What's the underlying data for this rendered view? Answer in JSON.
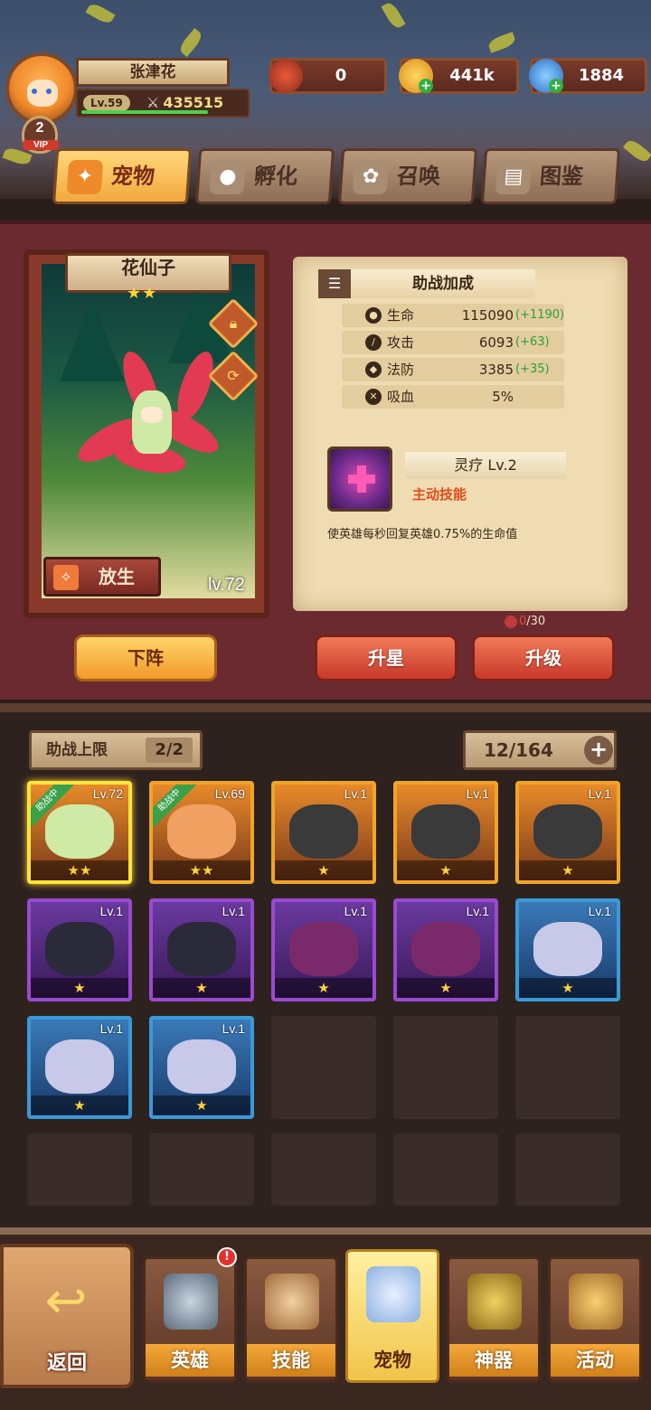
{
  "player": {
    "name": "张津花",
    "level": "Lv.59",
    "power": "435515",
    "vip_level": "2",
    "vip_label": "VIP"
  },
  "currencies": [
    {
      "name": "red-gem",
      "value": "0",
      "color": "#d0402a"
    },
    {
      "name": "gold-coin",
      "value": "441k",
      "color": "#f2b028"
    },
    {
      "name": "diamond",
      "value": "1884",
      "color": "#3a8ae8"
    }
  ],
  "top_tabs": [
    {
      "label": "宠物",
      "icon": "fox-icon",
      "active": true
    },
    {
      "label": "孵化",
      "icon": "egg-icon",
      "active": false
    },
    {
      "label": "召唤",
      "icon": "paw-icon",
      "active": false
    },
    {
      "label": "图鉴",
      "icon": "book-icon",
      "active": false
    }
  ],
  "pet": {
    "name": "花仙子",
    "stars": "★★",
    "level": "lv.72",
    "release_label": "放生"
  },
  "bonus": {
    "title": "助战加成",
    "stats": [
      {
        "icon": "drop-icon",
        "label": "生命",
        "value": "115090",
        "bonus": "(+1190)"
      },
      {
        "icon": "sword-icon",
        "label": "攻击",
        "value": "6093",
        "bonus": "(+63)"
      },
      {
        "icon": "shield-icon",
        "label": "法防",
        "value": "3385",
        "bonus": "(+35)"
      },
      {
        "icon": "swords-icon",
        "label": "吸血",
        "value": "5%",
        "bonus": ""
      }
    ]
  },
  "skill": {
    "name": "灵疗 Lv.2",
    "type": "主动技能",
    "description": "使英雄每秒回复英雄0.75%的生命值"
  },
  "upgrade_cost": {
    "have": "0",
    "need": "/30"
  },
  "actions": {
    "unassign": "下阵",
    "star_up": "升星",
    "level_up": "升级"
  },
  "list": {
    "assist_limit_label": "助战上限",
    "assist_limit_value": "2/2",
    "capacity": "12/164",
    "add": "+",
    "pets": [
      {
        "level": "Lv.72",
        "rarity": "gold",
        "stars": "★★",
        "in_battle": true,
        "ribbon": "助战中",
        "color": "#cfe9a6"
      },
      {
        "level": "Lv.69",
        "rarity": "gold",
        "stars": "★★",
        "in_battle": true,
        "ribbon": "助战中",
        "color": "#f0a060"
      },
      {
        "level": "Lv.1",
        "rarity": "gold",
        "stars": "★",
        "in_battle": false,
        "ribbon": "",
        "color": "#3a3a3a"
      },
      {
        "level": "Lv.1",
        "rarity": "gold",
        "stars": "★",
        "in_battle": false,
        "ribbon": "",
        "color": "#3a3a3a"
      },
      {
        "level": "Lv.1",
        "rarity": "gold",
        "stars": "★",
        "in_battle": false,
        "ribbon": "",
        "color": "#3a3a3a"
      },
      {
        "level": "Lv.1",
        "rarity": "purple",
        "stars": "★",
        "in_battle": false,
        "ribbon": "",
        "color": "#2a2a3a"
      },
      {
        "level": "Lv.1",
        "rarity": "purple",
        "stars": "★",
        "in_battle": false,
        "ribbon": "",
        "color": "#2a2a3a"
      },
      {
        "level": "Lv.1",
        "rarity": "purple",
        "stars": "★",
        "in_battle": false,
        "ribbon": "",
        "color": "#7a2a6a"
      },
      {
        "level": "Lv.1",
        "rarity": "purple",
        "stars": "★",
        "in_battle": false,
        "ribbon": "",
        "color": "#7a2a6a"
      },
      {
        "level": "Lv.1",
        "rarity": "blue",
        "stars": "★",
        "in_battle": false,
        "ribbon": "",
        "color": "#c8c8e8"
      },
      {
        "level": "Lv.1",
        "rarity": "blue",
        "stars": "★",
        "in_battle": false,
        "ribbon": "",
        "color": "#c8c8e8"
      },
      {
        "level": "Lv.1",
        "rarity": "blue",
        "stars": "★",
        "in_battle": false,
        "ribbon": "",
        "color": "#c8c8e8"
      }
    ]
  },
  "bottom_nav": {
    "back": "返回",
    "notify": "!",
    "items": [
      {
        "label": "英雄",
        "icon": "knight-helmet-icon",
        "active": false,
        "color": "#8a9aaa"
      },
      {
        "label": "技能",
        "icon": "spellbook-icon",
        "active": false,
        "color": "#d0a070"
      },
      {
        "label": "宠物",
        "icon": "winged-emblem-icon",
        "active": true,
        "color": "#b0c8f0"
      },
      {
        "label": "神器",
        "icon": "artifact-icon",
        "active": false,
        "color": "#c8a03a"
      },
      {
        "label": "活动",
        "icon": "horn-icon",
        "active": false,
        "color": "#d8a040"
      }
    ]
  }
}
